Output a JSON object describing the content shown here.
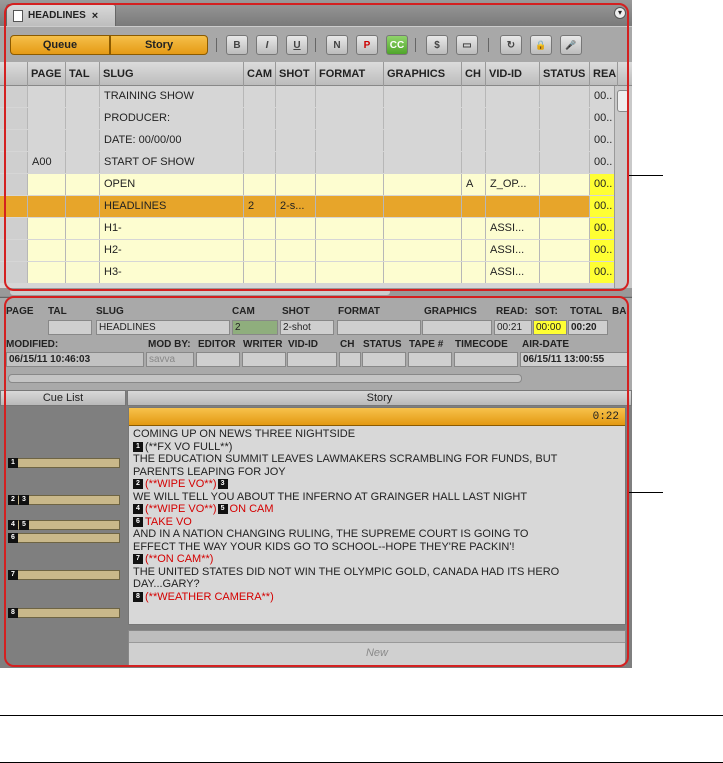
{
  "tab": {
    "title": "HEADLINES",
    "close": "×"
  },
  "toolbar": {
    "queue_label": "Queue",
    "story_label": "Story",
    "format_buttons": [
      "B",
      "I",
      "U",
      "N",
      "P",
      "CC",
      "$",
      "▭",
      "↻",
      "🔒",
      "🎤"
    ]
  },
  "grid": {
    "headers": [
      "PAGE",
      "TAL",
      "SLUG",
      "CAM",
      "SHOT",
      "FORMAT",
      "GRAPHICS",
      "CH",
      "VID-ID",
      "STATUS",
      "READ:"
    ],
    "rows": [
      {
        "page": "",
        "tal": "",
        "slug": "TRAINING SHOW",
        "cam": "",
        "shot": "",
        "ch": "",
        "vid": "",
        "read": "00..",
        "style": "grey"
      },
      {
        "page": "",
        "tal": "",
        "slug": "PRODUCER:",
        "cam": "",
        "shot": "",
        "ch": "",
        "vid": "",
        "read": "00..",
        "style": "grey"
      },
      {
        "page": "",
        "tal": "",
        "slug": "DATE: 00/00/00",
        "cam": "",
        "shot": "",
        "ch": "",
        "vid": "",
        "read": "00..",
        "style": "grey"
      },
      {
        "page": "A00",
        "tal": "",
        "slug": "START OF SHOW",
        "cam": "",
        "shot": "",
        "ch": "",
        "vid": "",
        "read": "00..",
        "style": "grey"
      },
      {
        "page": "",
        "tal": "",
        "slug": "OPEN",
        "cam": "",
        "shot": "",
        "ch": "A",
        "vid": "Z_OP...",
        "read": "00..",
        "style": "yellow"
      },
      {
        "page": "",
        "tal": "",
        "slug": "HEADLINES",
        "cam": "2",
        "shot": "2-s...",
        "ch": "",
        "vid": "",
        "read": "00..",
        "style": "sel"
      },
      {
        "page": "",
        "tal": "",
        "slug": "H1-",
        "cam": "",
        "shot": "",
        "ch": "",
        "vid": "ASSI...",
        "read": "00..",
        "style": "yellow"
      },
      {
        "page": "",
        "tal": "",
        "slug": "H2-",
        "cam": "",
        "shot": "",
        "ch": "",
        "vid": "ASSI...",
        "read": "00..",
        "style": "yellow"
      },
      {
        "page": "",
        "tal": "",
        "slug": "H3-",
        "cam": "",
        "shot": "",
        "ch": "",
        "vid": "ASSI...",
        "read": "00..",
        "style": "yellow"
      }
    ]
  },
  "detail": {
    "page_label": "PAGE",
    "tal_label": "TAL",
    "slug_label": "SLUG",
    "slug_value": "HEADLINES",
    "cam_label": "CAM",
    "cam_value": "2",
    "shot_label": "SHOT",
    "shot_value": "2-shot",
    "format_label": "FORMAT",
    "graphics_label": "GRAPHICS",
    "read_label": "READ:",
    "read_value": "00:21",
    "sot_label": "SOT:",
    "sot_value": "00:00",
    "total_label": "TOTAL",
    "total_value": "00:20",
    "ba_label": "BA",
    "modified_label": "MODIFIED:",
    "modified_value": "06/15/11 10:46:03",
    "modby_label": "MOD BY:",
    "modby_value": "savva",
    "editor_label": "EDITOR",
    "writer_label": "WRITER",
    "vidid_label": "VID-ID",
    "ch_label": "CH",
    "status_label": "STATUS",
    "tape_label": "TAPE #",
    "timecode_label": "TIMECODE",
    "airdate_label": "AIR-DATE",
    "airdate_value": "06/15/11 13:00:55"
  },
  "panes": {
    "cue_list_title": "Cue List",
    "story_title": "Story",
    "story_time": "0:22",
    "new_label": "New"
  },
  "story_lines": [
    {
      "text": "COMING UP ON NEWS THREE NIGHTSIDE"
    },
    {
      "badge": "1",
      "text": "(**FX VO FULL**)"
    },
    {
      "text": "THE EDUCATION SUMMIT LEAVES LAWMAKERS SCRAMBLING FOR FUNDS, BUT"
    },
    {
      "text": "PARENTS LEAPING FOR JOY"
    },
    {
      "badge": "2",
      "text": "(**WIPE VO**)",
      "badge2": "3"
    },
    {
      "text": "WE WILL TELL YOU ABOUT THE INFERNO AT GRAINGER HALL LAST NIGHT"
    },
    {
      "badge": "4",
      "text": "(**WIPE VO**)",
      "badge2": "5",
      "text2": "ON CAM"
    },
    {
      "badge": "6",
      "text": "TAKE VO"
    },
    {
      "text": "AND IN A NATION CHANGING RULING, THE SUPREME COURT IS GOING TO"
    },
    {
      "text": "EFFECT THE WAY YOUR KIDS GO TO SCHOOL--HOPE THEY'RE PACKIN'!"
    },
    {
      "badge": "7",
      "text": "(**ON CAM**)"
    },
    {
      "text": "THE UNITED STATES DID NOT WIN THE OLYMPIC GOLD, CANADA HAD ITS HERO"
    },
    {
      "text": "DAY...GARY?"
    },
    {
      "badge": "8",
      "text": "(**WEATHER CAMERA**)"
    }
  ],
  "cue_markers": [
    [
      "1"
    ],
    [
      "2",
      "3"
    ],
    [
      "4",
      "5"
    ],
    [
      "6"
    ],
    [
      "7"
    ],
    [
      "8"
    ]
  ],
  "colors": {
    "accent": "#e59a14",
    "highlight_yellow": "#ffff33",
    "callout_red": "#d42020"
  }
}
